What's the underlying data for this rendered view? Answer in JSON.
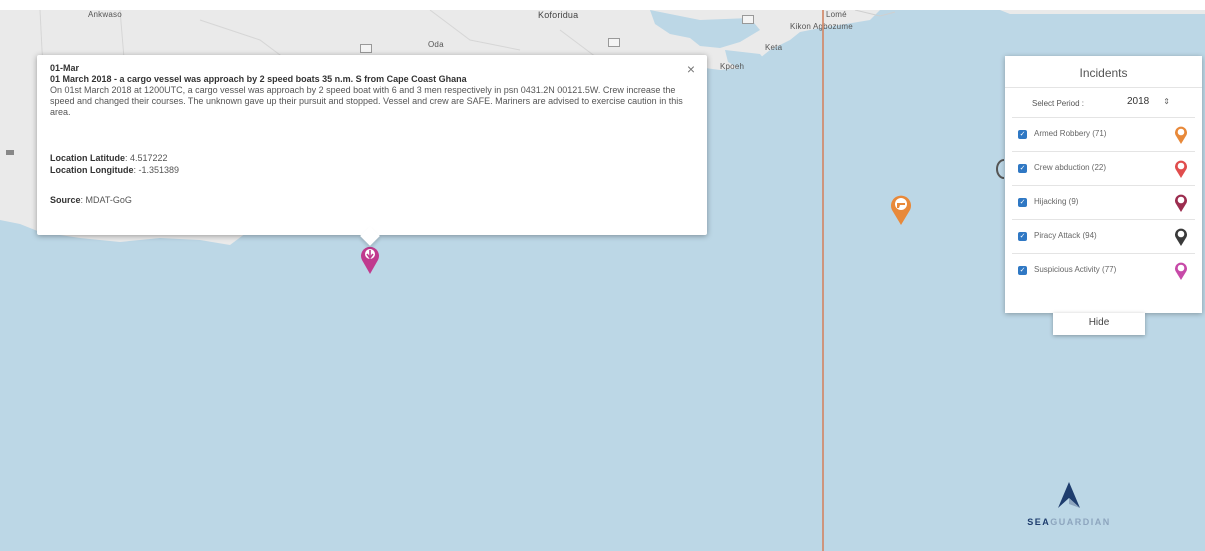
{
  "map": {
    "labels": {
      "anwiaso": "Ankwaso",
      "koforidua": "Koforidua",
      "oda": "Oda",
      "kikon": "Kikon Agbozume",
      "keta": "Keta",
      "lome": "Lomé",
      "kpoeh": "Kpoeh"
    },
    "colors": {
      "sea": "#bcd7e6",
      "land": "#eaeaea",
      "border": "#d18a6a"
    }
  },
  "popup": {
    "date": "01-Mar",
    "title": "01 March 2018 - a cargo vessel was approach by 2 speed boats 35 n.m. S from Cape Coast Ghana",
    "description": "On 01st March 2018 at 1200UTC, a cargo vessel was approach by 2 speed boat with 6 and 3 men respectively in psn 0431.2N 00121.5W. Crew increase the speed and changed their courses. The unknown gave up their pursuit and stopped. Vessel and crew are SAFE. Mariners are advised to exercise caution in this area.",
    "latitude_label": "Location Latitude",
    "latitude_value": ": 4.517222",
    "longitude_label": "Location Longitude",
    "longitude_value": ": -1.351389",
    "source_label": "Source",
    "source_value": ": MDAT-GoG",
    "close_glyph": "×"
  },
  "panel": {
    "title": "Incidents",
    "period_label": "Select Period :",
    "year": "2018",
    "year_arrows": "⇕",
    "items": [
      {
        "label": "Armed Robbery (71)",
        "color": "#e8893a",
        "icon": "armed-robbery-marker-icon"
      },
      {
        "label": "Crew abduction (22)",
        "color": "#e04d4d",
        "icon": "crew-abduction-marker-icon"
      },
      {
        "label": "Hijacking (9)",
        "color": "#9c2d4f",
        "icon": "hijacking-marker-icon"
      },
      {
        "label": "Piracy Attack (94)",
        "color": "#3a3a3a",
        "icon": "piracy-attack-marker-icon"
      },
      {
        "label": "Suspicious Activity (77)",
        "color": "#c74aa8",
        "icon": "suspicious-activity-marker-icon"
      }
    ],
    "check_glyph": "✓",
    "hide_label": "Hide"
  },
  "logo": {
    "part1": "SEA",
    "part2": "GUARDIAN",
    "color_primary": "#1e3d6e",
    "color_secondary": "#8da5be"
  }
}
